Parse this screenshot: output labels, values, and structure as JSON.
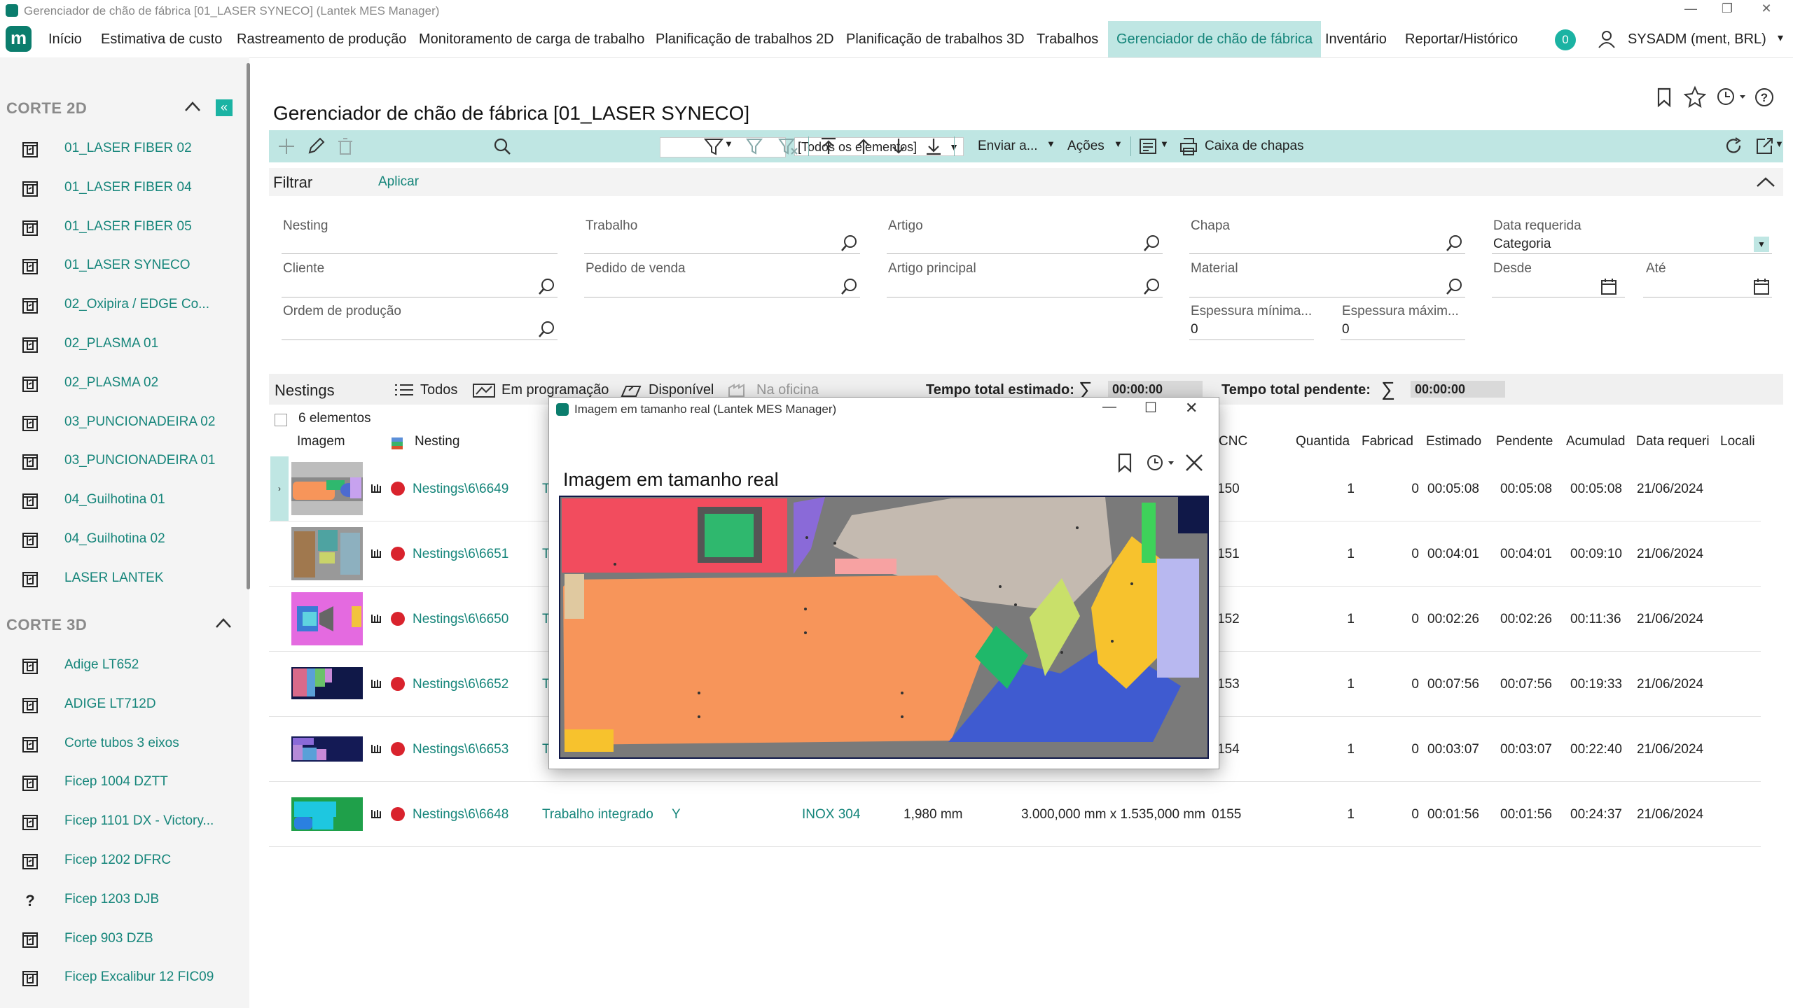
{
  "window": {
    "title": "Gerenciador de chão de fábrica [01_LASER SYNECO] (Lantek MES Manager)",
    "controls": [
      "—",
      "❐",
      "✕"
    ]
  },
  "menu": {
    "logo": "m",
    "items": [
      "Início",
      "Estimativa de custo",
      "Rastreamento de produção",
      "Monitoramento de carga de trabalho",
      "Planificação de trabalhos 2D",
      "Planificação de trabalhos 3D",
      "Trabalhos",
      "Gerenciador de chão de fábrica",
      "Inventário",
      "Reportar/Histórico"
    ],
    "active_index": 7,
    "notifications": "0",
    "user": "SYSADM (ment, BRL)",
    "accent": "#15857a"
  },
  "sidebar": {
    "section_2d": "CORTE 2D",
    "items_2d": [
      "01_LASER FIBER 02",
      "01_LASER FIBER 04",
      "01_LASER FIBER 05",
      "01_LASER SYNECO",
      "02_Oxipira / EDGE Co...",
      "02_PLASMA 01",
      "02_PLASMA 02",
      "03_PUNCIONADEIRA 02",
      "03_PUNCIONADEIRA 01",
      "04_Guilhotina 01",
      "04_Guilhotina 02",
      "LASER LANTEK"
    ],
    "section_3d": "CORTE 3D",
    "items_3d": [
      "Adige LT652",
      "ADIGE LT712D",
      "Corte tubos 3 eixos",
      "Ficep 1004 DZTT",
      "Ficep 1101 DX - Victory...",
      "Ficep 1202 DFRC",
      "Ficep 1203 DJB",
      "Ficep 903 DZB",
      "Ficep Excalibur 12 FIC09"
    ]
  },
  "main": {
    "title": "Gerenciador de chão de fábrica [01_LASER SYNECO]",
    "toolbar": {
      "search_value": "",
      "elements_combo": "[Todos os elementos]",
      "send_to": "Enviar a...",
      "actions": "Ações",
      "sheet_box": "Caixa de chapas"
    },
    "filter": {
      "title": "Filtrar",
      "apply": "Aplicar",
      "fields": {
        "nesting": "Nesting",
        "trabalho": "Trabalho",
        "artigo": "Artigo",
        "chapa": "Chapa",
        "data_requerida": "Data requerida",
        "categoria": "Categoria",
        "cliente": "Cliente",
        "pedido": "Pedido de venda",
        "artigo_principal": "Artigo principal",
        "material": "Material",
        "desde": "Desde",
        "ate": "Até",
        "ordem": "Ordem de produção",
        "esp_min": "Espessura mínima...",
        "esp_min_value": "0",
        "esp_max": "Espessura máxim...",
        "esp_max_value": "0"
      }
    },
    "nestings_bar": {
      "title": "Nestings",
      "todos": "Todos",
      "em_programacao": "Em programação",
      "disponivel": "Disponível",
      "na_oficina": "Na oficina",
      "tempo_estimado_label": "Tempo total estimado:",
      "tempo_estimado": "00:00:00",
      "tempo_pendente_label": "Tempo total pendente:",
      "tempo_pendente": "00:00:00"
    },
    "element_count": "6 elementos",
    "columns": {
      "imagem": "Imagem",
      "nesting": "Nesting",
      "cnc": "CNC",
      "quantidade": "Quantida",
      "fabricado": "Fabricad",
      "estimado": "Estimado",
      "pendente": "Pendente",
      "acumulado": "Acumulad",
      "data": "Data requeri",
      "local": "Locali"
    },
    "rows": [
      {
        "nesting": "Nestings\\6\\6649",
        "t": "T",
        "cnc": "150",
        "qtd": "1",
        "fab": "0",
        "est": "00:05:08",
        "pend": "00:05:08",
        "acum": "00:05:08",
        "data": "21/06/2024"
      },
      {
        "nesting": "Nestings\\6\\6651",
        "t": "T",
        "cnc": "151",
        "qtd": "1",
        "fab": "0",
        "est": "00:04:01",
        "pend": "00:04:01",
        "acum": "00:09:10",
        "data": "21/06/2024"
      },
      {
        "nesting": "Nestings\\6\\6650",
        "t": "T",
        "cnc": "152",
        "qtd": "1",
        "fab": "0",
        "est": "00:02:26",
        "pend": "00:02:26",
        "acum": "00:11:36",
        "data": "21/06/2024"
      },
      {
        "nesting": "Nestings\\6\\6652",
        "t": "T",
        "cnc": "153",
        "qtd": "1",
        "fab": "0",
        "est": "00:07:56",
        "pend": "00:07:56",
        "acum": "00:19:33",
        "data": "21/06/2024"
      },
      {
        "nesting": "Nestings\\6\\6653",
        "t": "T",
        "cnc": "154",
        "qtd": "1",
        "fab": "0",
        "est": "00:03:07",
        "pend": "00:03:07",
        "acum": "00:22:40",
        "data": "21/06/2024"
      },
      {
        "nesting": "Nestings\\6\\6648",
        "trabalho": "Trabalho integrado",
        "y": "Y",
        "material": "INOX 304",
        "espessura": "1,980 mm",
        "dims": "3.000,000 mm x 1.535,000 mm",
        "cnc": "0155",
        "qtd": "1",
        "fab": "0",
        "est": "00:01:56",
        "pend": "00:01:56",
        "acum": "00:24:37",
        "data": "21/06/2024"
      }
    ]
  },
  "popup": {
    "window_title": "Imagem em tamanho real (Lantek MES Manager)",
    "heading": "Imagem em tamanho real"
  }
}
